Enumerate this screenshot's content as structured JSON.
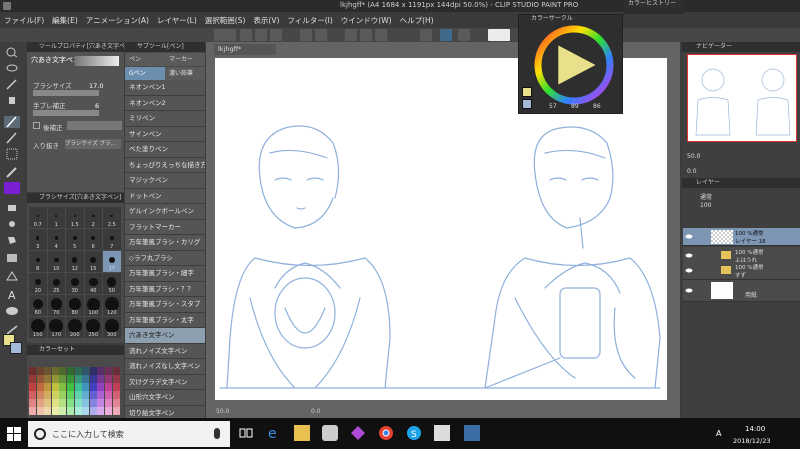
{
  "app": {
    "title": "lkjhgff* (A4 1684 x 1191px 144dpi 50.0%) - CLIP STUDIO PAINT PRO",
    "document_tab": "lkjhgff*"
  },
  "menu": [
    "ファイル(F)",
    "編集(E)",
    "アニメーション(A)",
    "レイヤー(L)",
    "選択範囲(S)",
    "表示(V)",
    "フィルター(I)",
    "ウインドウ(W)",
    "ヘルプ(H)"
  ],
  "tool_property": {
    "header": "ツールプロパティ[穴あき文字ペン]",
    "preset_name": "穴あき文字ペン",
    "brush_size_label": "ブラシサイズ",
    "brush_size_value": "17.0",
    "stabilization_label": "手ブレ補正",
    "stabilization_value": "6",
    "post_correction_label": "後補正",
    "taper_label": "入り抜き",
    "taper_value": "ブラシサイズ ブラ..."
  },
  "sub_tool": {
    "header": "サブツール[ペン]",
    "tabs": [
      "ペン",
      "マーカー",
      "Gペン",
      "濃い鉛筆"
    ],
    "items": [
      {
        "label": "ネオンペン1"
      },
      {
        "label": "ネオンペン2"
      },
      {
        "label": "ミリペン"
      },
      {
        "label": "サインペン"
      },
      {
        "label": "べた塗りペン"
      },
      {
        "label": "ちょっぴりえっちな描き方"
      },
      {
        "label": "マジックペン"
      },
      {
        "label": "ドットペン"
      },
      {
        "label": "ゲルインクボールペン"
      },
      {
        "label": "フラットマーカー"
      },
      {
        "label": "万年筆風ブラシ・カリグ"
      },
      {
        "label": "◇ラフ丸ブラシ"
      },
      {
        "label": "万年筆風ブラシ・細字"
      },
      {
        "label": "万年筆風ブラシ・？？"
      },
      {
        "label": "万年筆風ブラシ・スタブ"
      },
      {
        "label": "万年筆風ブラシ・太字"
      },
      {
        "label": "穴あき文字ペン"
      },
      {
        "label": "流れノイズ文字ペン"
      },
      {
        "label": "流れノイズなし文字ペン"
      },
      {
        "label": "欠けグラデ文字ペン"
      },
      {
        "label": "山形穴文字ペン"
      },
      {
        "label": "切り絵文字ペン"
      },
      {
        "label": "フチだけ文字ペン"
      },
      {
        "label": "フチ文字ペン"
      }
    ],
    "selected_index": 16
  },
  "brush_size_panel": {
    "header": "ブラシサイズ[穴あき文字ペン]",
    "sizes": [
      "0.7",
      "1",
      "1.5",
      "2",
      "2.5",
      "3",
      "4",
      "5",
      "6",
      "7",
      "8",
      "10",
      "12",
      "15",
      "17",
      "20",
      "25",
      "30",
      "40",
      "50",
      "60",
      "70",
      "80",
      "100",
      "120",
      "150",
      "170",
      "200",
      "250",
      "300"
    ]
  },
  "color_set": {
    "header": "カラーセット"
  },
  "color_wheel": {
    "header": "カラーサークル",
    "h_value": "57",
    "s_value": "89",
    "v_value": "86"
  },
  "color_history_header": "カラーヒストリー",
  "navigator": {
    "header": "ナビゲーター",
    "zoom": "50.0",
    "rotation": "0.0"
  },
  "layer_panel": {
    "header": "レイヤー",
    "blend_mode": "通常",
    "opacity": "100",
    "layers": [
      {
        "line1": "100 %通常",
        "line2": "レイヤー 18",
        "selected": true
      },
      {
        "line1": "100 %通常",
        "line2": "よはうれ",
        "selected": false
      },
      {
        "line1": "100 %通常",
        "line2": "すず",
        "selected": false
      },
      {
        "line1": "",
        "line2": "用紙",
        "selected": false
      }
    ]
  },
  "canvas_status": {
    "zoom": "50.0",
    "rotation": "0.0"
  },
  "taskbar": {
    "search_placeholder": "ここに入力して検索",
    "time": "14:00",
    "date": "2018/12/23",
    "ime": "A"
  },
  "colors": {
    "main_color": "#e8e08a",
    "sub_color": "#a4b8d8",
    "ink": "#8fb1dc",
    "accent": "#7d96b4"
  }
}
